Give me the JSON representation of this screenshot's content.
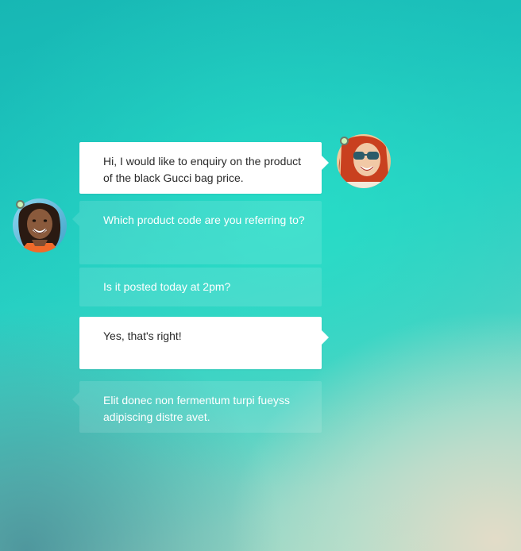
{
  "messages": [
    {
      "id": "b1",
      "sender": "customer",
      "text": "Hi, I would like to enquiry on the product of the black Gucci bag price."
    },
    {
      "id": "b2",
      "sender": "agent",
      "text": "Which product code are you referring to?"
    },
    {
      "id": "b3",
      "sender": "agent",
      "text": "Is it posted today at 2pm?"
    },
    {
      "id": "b4",
      "sender": "customer",
      "text": "Yes, that's right!"
    },
    {
      "id": "b5",
      "sender": "agent",
      "text": "Elit donec non fermentum turpi fueyss adipiscing distre avet."
    }
  ],
  "avatars": {
    "right": {
      "icon": "avatar-woman-sunglasses",
      "status_color": "#c8f3b8"
    },
    "left": {
      "icon": "avatar-woman-smiling",
      "status_color": "#c8f3b8"
    }
  },
  "colors": {
    "outgoing_bubble": "#ffffff",
    "incoming_bubble": "rgba(255,255,255,0.12)",
    "background_top": "#17b7b4"
  }
}
